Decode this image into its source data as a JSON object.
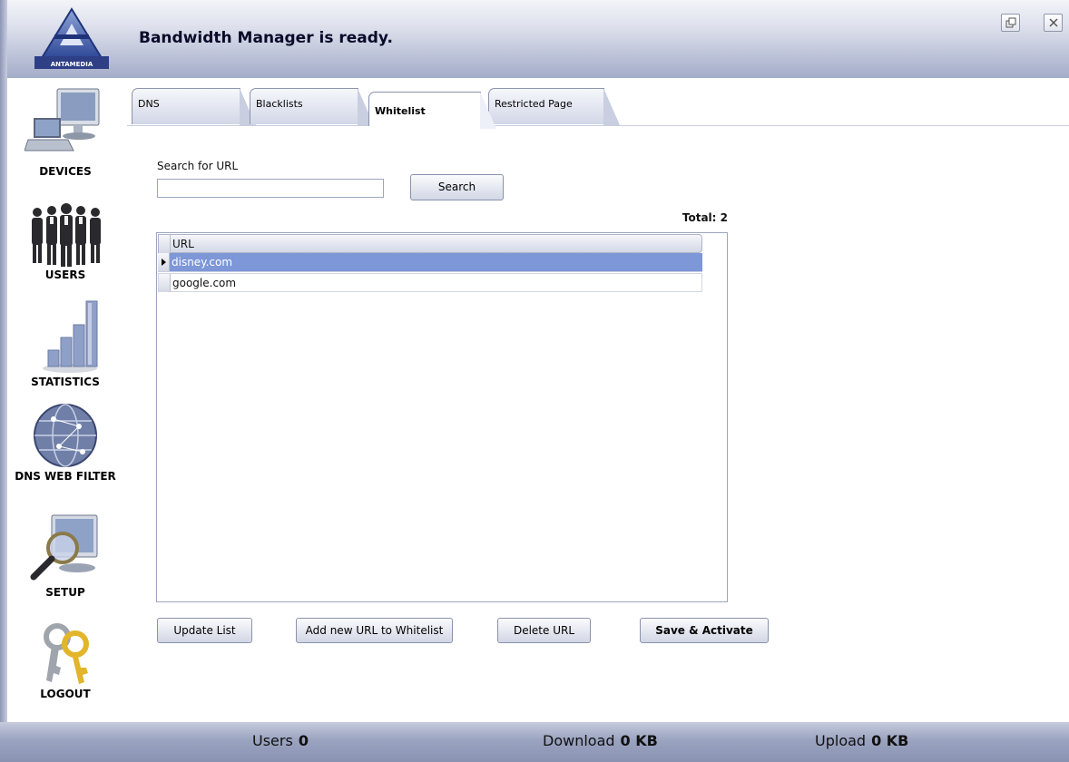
{
  "header": {
    "logo_text": "ANTAMEDIA",
    "title": "Bandwidth Manager is ready."
  },
  "sidebar": {
    "items": [
      {
        "label": "DEVICES",
        "icon": "computer-icon"
      },
      {
        "label": "USERS",
        "icon": "users-icon"
      },
      {
        "label": "STATISTICS",
        "icon": "bar-chart-icon"
      },
      {
        "label": "DNS WEB FILTER",
        "icon": "globe-icon"
      },
      {
        "label": "SETUP",
        "icon": "magnifier-monitor-icon"
      },
      {
        "label": "LOGOUT",
        "icon": "keys-icon"
      }
    ]
  },
  "tabs": [
    {
      "label": "DNS",
      "active": false
    },
    {
      "label": "Blacklists",
      "active": false
    },
    {
      "label": "Whitelist",
      "active": true
    },
    {
      "label": "Restricted Page",
      "active": false
    }
  ],
  "search": {
    "label": "Search for URL",
    "value": "",
    "button_label": "Search"
  },
  "total_label": "Total: 2",
  "grid": {
    "column": "URL",
    "rows": [
      {
        "url": "disney.com",
        "selected": true
      },
      {
        "url": "google.com",
        "selected": false
      }
    ]
  },
  "actions": {
    "update": "Update List",
    "add": "Add new URL to Whitelist",
    "delete": "Delete URL",
    "save": "Save & Activate"
  },
  "status": {
    "users_label": "Users",
    "users_value": "0",
    "download_label": "Download",
    "download_value": "0 KB",
    "upload_label": "Upload",
    "upload_value": "0 KB"
  },
  "colors": {
    "selected_row": "#7d97d8",
    "header_gradient_end": "#a3acc8"
  }
}
